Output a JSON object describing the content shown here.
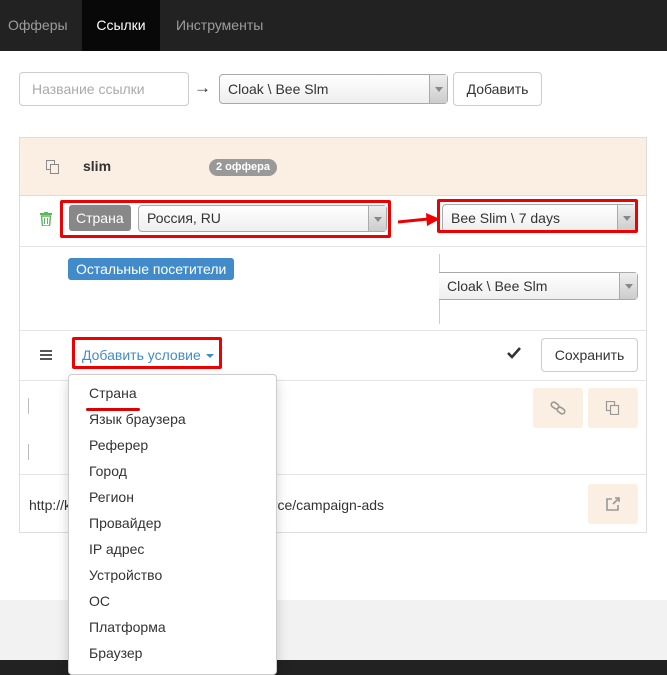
{
  "nav": {
    "tabs": [
      {
        "label": "Офферы",
        "active": false
      },
      {
        "label": "Ссылки",
        "active": true
      },
      {
        "label": "Инструменты",
        "active": false
      }
    ]
  },
  "new_link": {
    "name_placeholder": "Название ссылки",
    "arrow": "→",
    "offer_select": "Cloak \\ Bee Slm",
    "add_button": "Добавить"
  },
  "panel": {
    "title": "slim",
    "badge": "2 оффера",
    "rule": {
      "condition_label": "Страна",
      "country_value": "Россия, RU",
      "offer_value": "Bee Slim \\ 7 days"
    },
    "others": {
      "label": "Остальные посетители",
      "offer_value": "Cloak \\ Bee Slm"
    },
    "add_condition_label": "Добавить условие",
    "save_button": "Сохранить",
    "url_prefix": "http://k",
    "url_suffix": "urce/campaign-ads"
  },
  "condition_menu": {
    "items": [
      "Страна",
      "Язык браузера",
      "Реферер",
      "Город",
      "Регион",
      "Провайдер",
      "IP адрес",
      "Устройство",
      "ОС",
      "Платформа",
      "Браузер"
    ]
  },
  "icons": [
    "copy-icon",
    "trash-icon",
    "hamburger-icon",
    "check-icon",
    "link-icon",
    "external-link-icon",
    "chevron-down-icon",
    "arrow-right-icon"
  ],
  "colors": {
    "nav_bg": "#222222",
    "panel_head_bg": "#fbeee2",
    "accent_blue": "#428bca",
    "annotation_red": "#e00000",
    "badge_gray": "#999999"
  }
}
